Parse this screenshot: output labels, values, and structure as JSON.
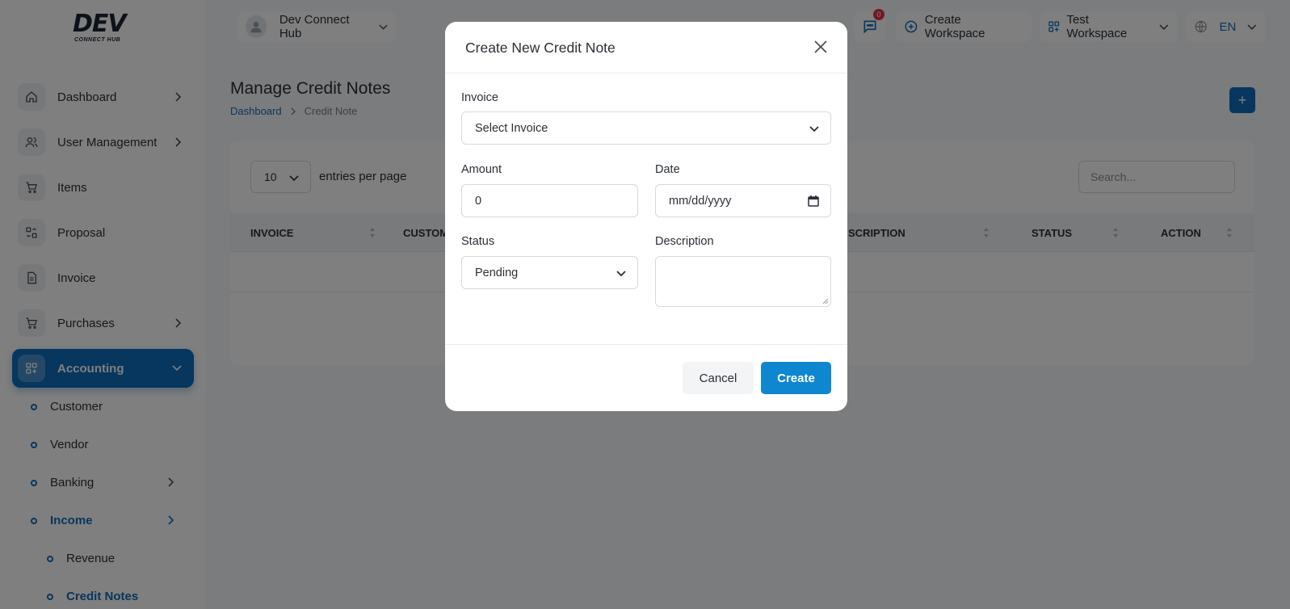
{
  "brand": {
    "name": "DEV",
    "tagline": "CONNECT HUB"
  },
  "sidebar": {
    "items": [
      {
        "label": "Dashboard",
        "icon": "home-icon",
        "has_chevron": true
      },
      {
        "label": "User Management",
        "icon": "users-icon",
        "has_chevron": true
      },
      {
        "label": "Items",
        "icon": "cart-icon",
        "has_chevron": false
      },
      {
        "label": "Proposal",
        "icon": "swap-icon",
        "has_chevron": false
      },
      {
        "label": "Invoice",
        "icon": "file-icon",
        "has_chevron": false
      },
      {
        "label": "Purchases",
        "icon": "cart-icon",
        "has_chevron": true
      },
      {
        "label": "Accounting",
        "icon": "grid-plus-icon",
        "has_chevron": true,
        "active": true
      }
    ],
    "sub_items": [
      {
        "label": "Customer"
      },
      {
        "label": "Vendor"
      },
      {
        "label": "Banking",
        "has_chevron": true
      },
      {
        "label": "Income",
        "has_chevron": true,
        "active": true
      },
      {
        "label": "Revenue",
        "indent": true
      },
      {
        "label": "Credit Notes",
        "indent": true,
        "active": true
      }
    ]
  },
  "header": {
    "workspace_owner": "Dev Connect Hub",
    "notification_count": "0",
    "create_workspace": "Create Workspace",
    "current_workspace": "Test Workspace",
    "language": "EN"
  },
  "page": {
    "title": "Manage Credit Notes",
    "breadcrumb": {
      "home": "Dashboard",
      "current": "Credit Note"
    },
    "add_label": "+"
  },
  "table": {
    "per_page": "10",
    "per_page_label": "entries per page",
    "search_placeholder": "Search...",
    "columns": [
      "INVOICE",
      "CUSTOM",
      "SCRIPTION",
      "STATUS",
      "ACTION"
    ]
  },
  "modal": {
    "title": "Create New Credit Note",
    "invoice_label": "Invoice",
    "invoice_value": "Select Invoice",
    "amount_label": "Amount",
    "amount_value": "0",
    "date_label": "Date",
    "date_placeholder": "mm/dd/yyyy",
    "status_label": "Status",
    "status_value": "Pending",
    "description_label": "Description",
    "cancel_label": "Cancel",
    "create_label": "Create"
  },
  "colors": {
    "primary": "#0f6cbd",
    "create_button": "#0f86d0",
    "badge": "#e3324a"
  }
}
